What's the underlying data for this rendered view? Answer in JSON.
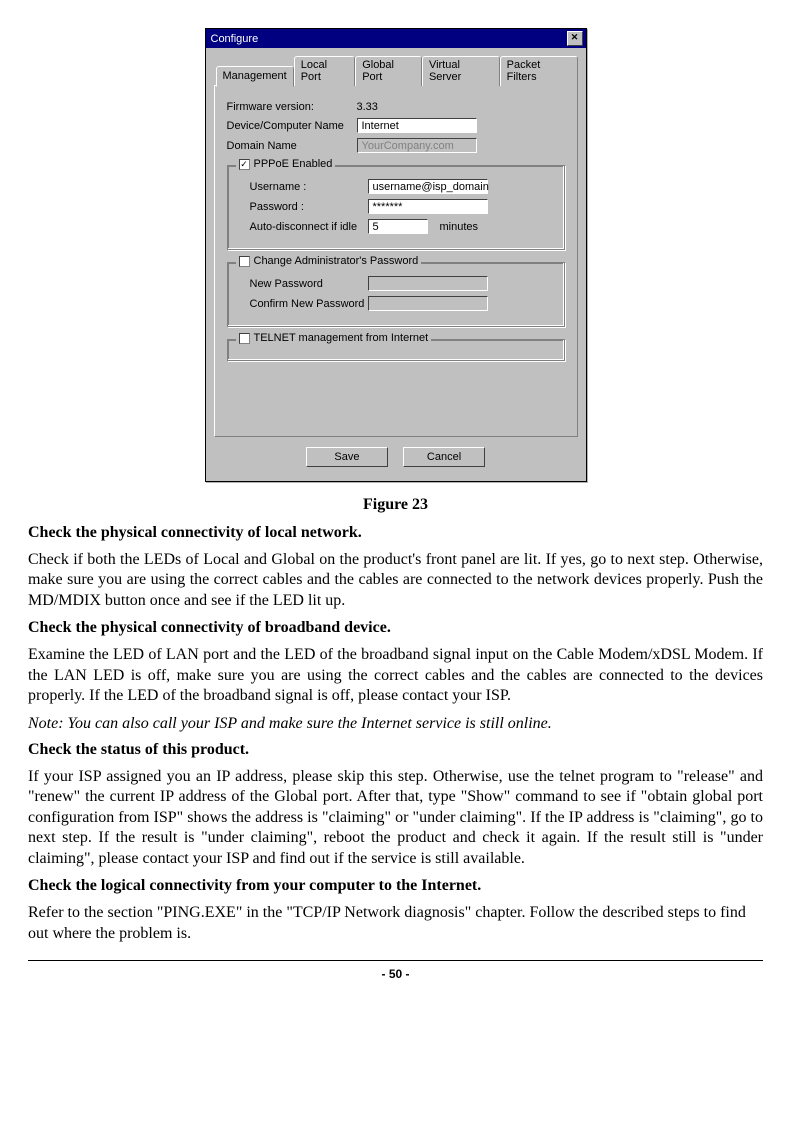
{
  "dialog": {
    "title": "Configure",
    "close_glyph": "✕",
    "tabs": [
      "Management",
      "Local Port",
      "Global Port",
      "Virtual Server",
      "Packet Filters"
    ],
    "active_tab": 0,
    "mgmt": {
      "firmware_label": "Firmware version:",
      "firmware_value": "3.33",
      "device_name_label": "Device/Computer Name",
      "device_name_value": "Internet",
      "domain_label": "Domain Name",
      "domain_value": "YourCompany.com",
      "pppoe": {
        "checkbox_label": "PPPoE Enabled",
        "checked": true,
        "username_label": "Username :",
        "username_value": "username@isp_domain",
        "password_label": "Password :",
        "password_value": "*******",
        "idle_label": "Auto-disconnect if idle",
        "idle_value": "5",
        "idle_unit": "minutes"
      },
      "admin": {
        "checkbox_label": "Change Administrator's Password",
        "checked": false,
        "new_pw_label": "New Password",
        "confirm_pw_label": "Confirm New Password"
      },
      "telnet": {
        "checkbox_label": "TELNET management from Internet",
        "checked": false
      }
    },
    "buttons": {
      "save": "Save",
      "cancel": "Cancel"
    }
  },
  "figure_caption": "Figure 23",
  "sections": {
    "s1_h": "Check the physical connectivity of local network.",
    "s1_p": "Check if both the LEDs of Local and Global on the product's front panel are lit. If yes, go to next step.  Otherwise, make sure you are using the correct cables and the cables are connected to the network devices properly. Push the MD/MDIX button once and see if the LED lit up.",
    "s2_h": "Check the physical connectivity of broadband device.",
    "s2_p": "Examine the LED of LAN port and the LED of the broadband signal input on the Cable Modem/xDSL Modem.  If the LAN LED is off, make sure you are using the correct cables and the cables are connected to the devices properly. If the LED of the broadband signal is off, please contact your ISP.",
    "note": "Note: You can also call your ISP and make sure the Internet service is still online.",
    "s3_h": "Check the status of this product.",
    "s3_p": "If your ISP assigned you an IP address, please skip this step. Otherwise, use the telnet program to \"release\" and \"renew\" the current IP address of the Global port. After that, type \"Show\" command to see if \"obtain global port configuration from ISP\" shows the address is \"claiming\" or \"under claiming\". If the IP address is \"claiming\", go to next step. If the result is \"under claiming\", reboot the product and check it again. If the result still is \"under claiming\", please contact your ISP and find out if the service is still available.",
    "s4_h": "Check the logical connectivity from your computer to the Internet.",
    "s4_p": "Refer to the section \"PING.EXE\" in the \"TCP/IP Network diagnosis\" chapter.  Follow the described steps to find out where the problem is."
  },
  "page_number": "- 50 -"
}
